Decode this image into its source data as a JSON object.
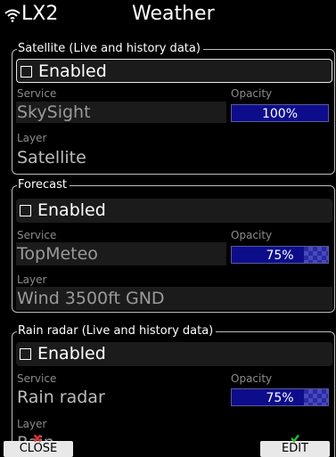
{
  "titlebar": {
    "device": "LX2",
    "title": "Weather",
    "wifi_icon": "wifi-icon"
  },
  "sections": [
    {
      "label": "Satellite (Live and history data)",
      "enabled_label": "Enabled",
      "enabled_checked": false,
      "service_label": "Service",
      "service_value": "SkySight",
      "opacity_label": "Opacity",
      "opacity_value": "100%",
      "opacity_fraction": 1.0,
      "layer_label": "Layer",
      "layer_value": "Satellite"
    },
    {
      "label": "Forecast",
      "enabled_label": "Enabled",
      "enabled_checked": false,
      "service_label": "Service",
      "service_value": "TopMeteo",
      "opacity_label": "Opacity",
      "opacity_value": "75%",
      "opacity_fraction": 0.75,
      "layer_label": "Layer",
      "layer_value": "Wind 3500ft GND"
    },
    {
      "label": "Rain radar (Live and history data)",
      "enabled_label": "Enabled",
      "enabled_checked": false,
      "service_label": "Service",
      "service_value": "Rain radar",
      "opacity_label": "Opacity",
      "opacity_value": "75%",
      "opacity_fraction": 0.75,
      "layer_label": "Layer",
      "layer_value": "Rain"
    }
  ],
  "buttons": {
    "close_label": "CLOSE",
    "edit_label": "EDIT",
    "close_icon": "red-x-icon",
    "edit_icon": "green-check-icon"
  },
  "colors": {
    "background": "#000000",
    "field": "#1b1b1b",
    "opacity_bar": "#0d0d8c",
    "close_icon": "#e03030",
    "edit_icon": "#2fb82f"
  }
}
